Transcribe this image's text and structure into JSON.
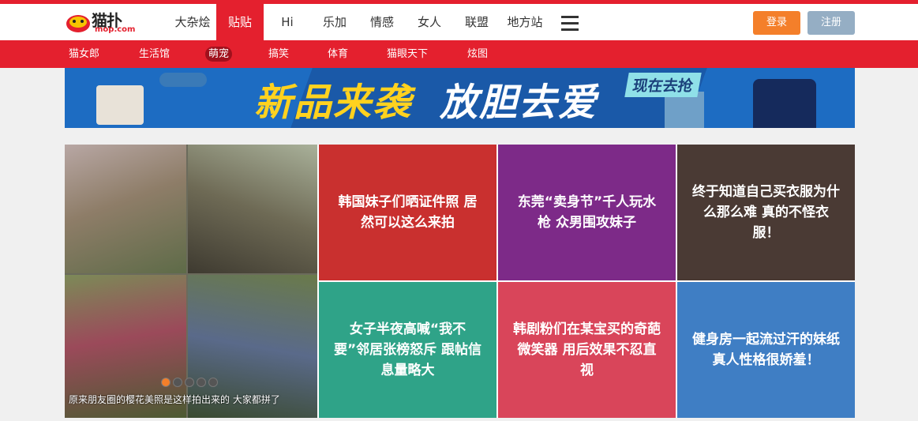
{
  "header": {
    "logo_text": "猫扑",
    "logo_sub": "mop.com",
    "nav": [
      "大杂烩",
      "贴贴",
      "Hi",
      "乐加",
      "情感",
      "女人",
      "联盟",
      "地方站"
    ],
    "login_label": "登录",
    "register_label": "注册"
  },
  "subnav": [
    "猫女郎",
    "生活馆",
    "萌宠",
    "搞笑",
    "体育",
    "猫眼天下",
    "炫图"
  ],
  "banner": {
    "title_a": "新品来袭",
    "title_b": "放胆去爱",
    "cta": "现在去抢"
  },
  "feature": {
    "caption": "原来朋友圈的樱花美照是这样拍出来的 大家都拼了",
    "slides": 5,
    "active_slide": 1
  },
  "tiles": [
    {
      "title": "韩国妹子们晒证件照 居然可以这么来拍",
      "color": "#c9302f"
    },
    {
      "title": "东莞“卖身节”千人玩水枪 众男围攻妹子",
      "color": "#7d2a88"
    },
    {
      "title": "终于知道自己买衣服为什么那么难 真的不怪衣服！",
      "color": "#4a3a34"
    },
    {
      "title": "女子半夜高喊“我不要”邻居张榜怒斥 跟帖信息量略大",
      "color": "#2fa388"
    },
    {
      "title": "韩剧粉们在某宝买的奇葩微笑器 用后效果不忍直视",
      "color": "#d9455a"
    },
    {
      "title": "健身房一起流过汗的妹纸 真人性格很娇羞！",
      "color": "#3f7ec4"
    }
  ]
}
